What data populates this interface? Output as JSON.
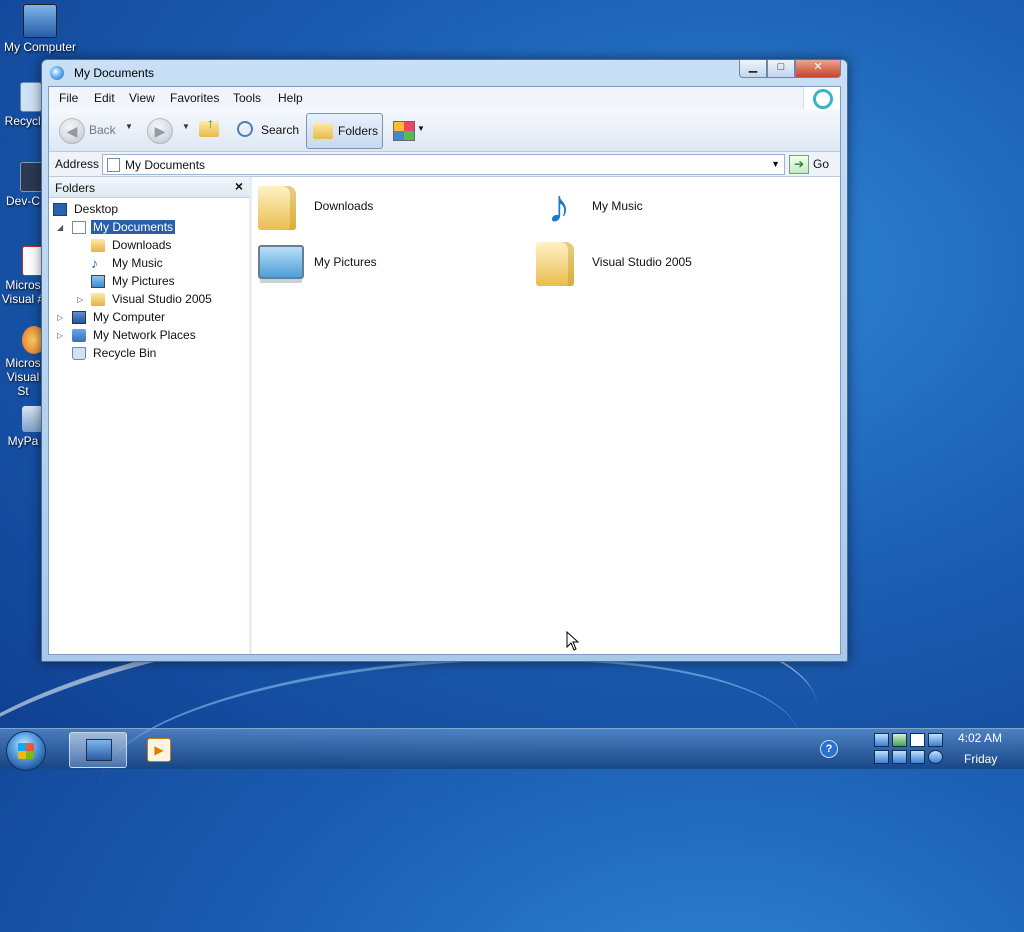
{
  "desktop": {
    "icons": [
      {
        "label": "My Computer"
      },
      {
        "label": "Recycle"
      },
      {
        "label": "Dev-C"
      },
      {
        "label": "Micros Visual #"
      },
      {
        "label": "Micros Visual St"
      },
      {
        "label": "MyPa"
      }
    ]
  },
  "window": {
    "title": "My Documents",
    "caption_buttons": {
      "minimize": "▁",
      "maximize": "□",
      "close": "✕"
    }
  },
  "menubar": {
    "items": [
      "File",
      "Edit",
      "View",
      "Favorites",
      "Tools",
      "Help"
    ]
  },
  "toolbar": {
    "back_label": "Back",
    "search_label": "Search",
    "folders_label": "Folders",
    "back_icon": "◀",
    "forward_icon": "▶",
    "dropdown_glyph": "▼"
  },
  "address": {
    "label": "Address",
    "value": "My Documents",
    "dropdown_glyph": "▼",
    "go_label": "Go",
    "go_icon": "➔"
  },
  "folders_pane": {
    "title": "Folders",
    "close_glyph": "×",
    "tree": [
      {
        "label": "Desktop"
      },
      {
        "label": "My Documents"
      },
      {
        "label": "Downloads"
      },
      {
        "label": "My Music"
      },
      {
        "label": "My Pictures"
      },
      {
        "label": "Visual Studio 2005"
      },
      {
        "label": "My Computer"
      },
      {
        "label": "My Network Places"
      },
      {
        "label": "Recycle Bin"
      }
    ],
    "expander_open": "◢",
    "expander_closed": "▷"
  },
  "content": {
    "items": [
      {
        "label": "Downloads"
      },
      {
        "label": "My Music"
      },
      {
        "label": "My Pictures"
      },
      {
        "label": "Visual Studio 2005"
      }
    ],
    "music_glyph": "♪"
  },
  "taskbar": {
    "help_glyph": "?",
    "clock_time": "4:02 AM",
    "clock_day": "Friday",
    "media_glyph": "▶"
  }
}
